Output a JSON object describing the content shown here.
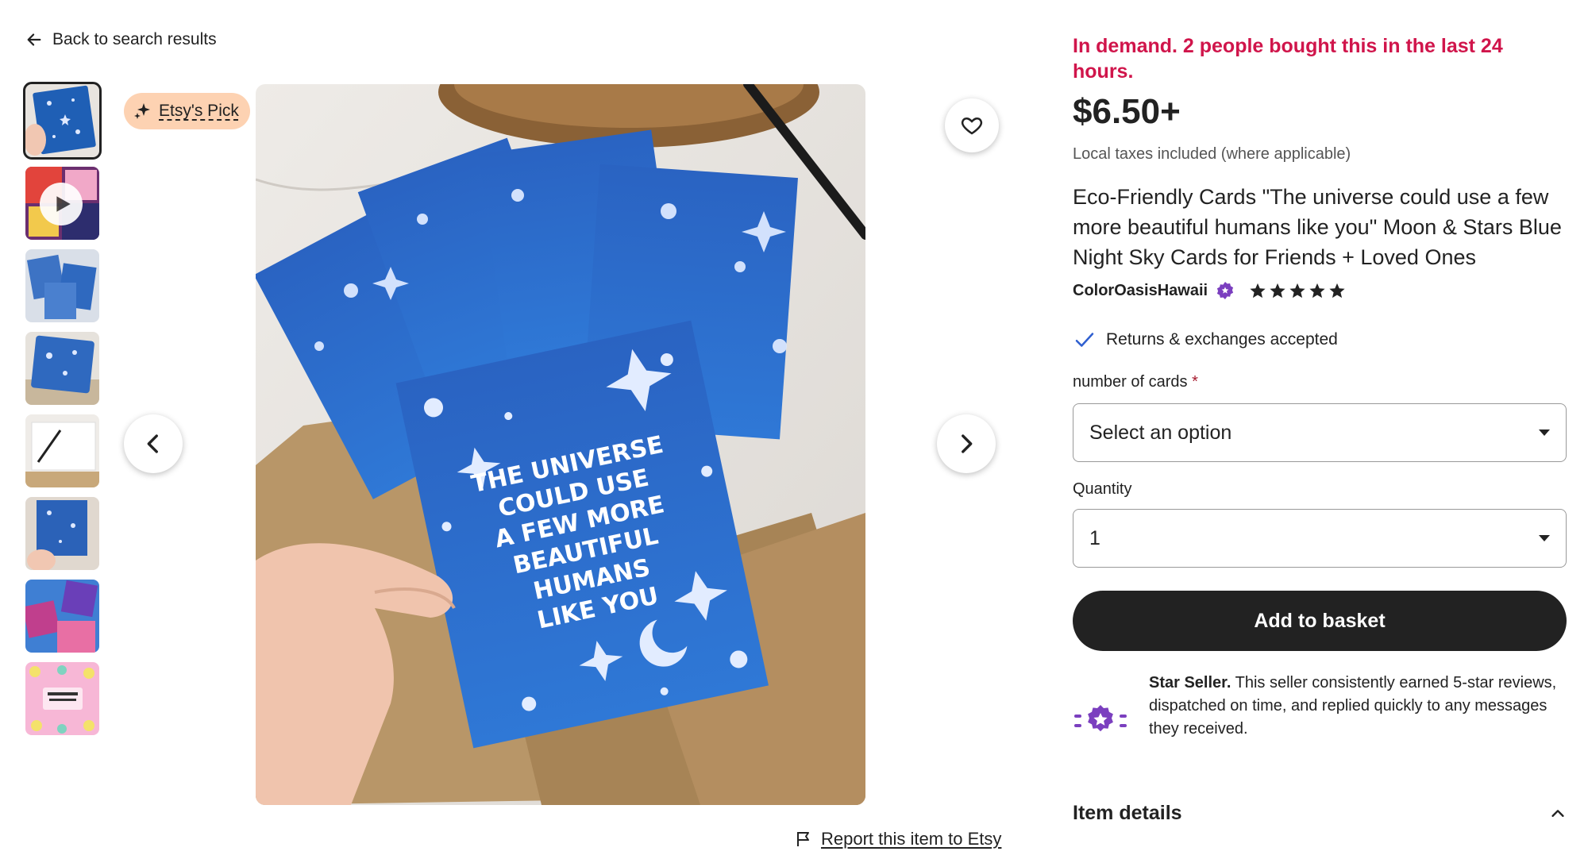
{
  "nav": {
    "back_label": "Back to search results"
  },
  "gallery": {
    "badge_label": "Etsy's Pick",
    "thumbnails": [
      {
        "kind": "image",
        "colors": [
          "#1f5fb5",
          "#e8e4df"
        ]
      },
      {
        "kind": "video",
        "colors": [
          "#6b2f6f",
          "#e2443c"
        ]
      },
      {
        "kind": "image",
        "colors": [
          "#3d73c4",
          "#d9dfe8"
        ]
      },
      {
        "kind": "image",
        "colors": [
          "#2f69bf",
          "#c8b79c"
        ]
      },
      {
        "kind": "image",
        "colors": [
          "#efece8",
          "#222222"
        ]
      },
      {
        "kind": "image",
        "colors": [
          "#2b62b8",
          "#e0d8cf"
        ]
      },
      {
        "kind": "image",
        "colors": [
          "#3f7fd3",
          "#c03f8d"
        ]
      },
      {
        "kind": "image",
        "colors": [
          "#f7b7d6",
          "#f4e26a"
        ]
      }
    ],
    "card_text": [
      "THE UNIVERSE",
      "COULD USE",
      "A FEW MORE",
      "BEAUTIFUL",
      "HUMANS",
      "LIKE YOU"
    ]
  },
  "report_label": "Report this item to Etsy",
  "listing": {
    "demand_text": "In demand. 2 people bought this in the last 24 hours.",
    "price": "$6.50+",
    "tax_note": "Local taxes included (where applicable)",
    "title": "Eco-Friendly Cards \"The universe could use a few more beautiful humans like you\" Moon & Stars Blue Night Sky Cards for Friends + Loved Ones",
    "shop_name": "ColorOasisHawaii",
    "rating_stars": 5,
    "returns_text": "Returns & exchanges accepted",
    "option_label": "number of cards",
    "option_required_mark": "*",
    "option_value": "Select an option",
    "quantity_label": "Quantity",
    "quantity_value": "1",
    "add_button": "Add to basket",
    "star_seller_title": "Star Seller.",
    "star_seller_text": "This seller consistently earned 5-star reviews, dispatched on time, and replied quickly to any messages they received.",
    "item_details_label": "Item details"
  },
  "colors": {
    "demand": "#d0154b",
    "button_bg": "#222222",
    "badge_bg": "#fdd2b2",
    "star_seller_purple": "#7b3fbf",
    "check_blue": "#2f5fd0"
  }
}
